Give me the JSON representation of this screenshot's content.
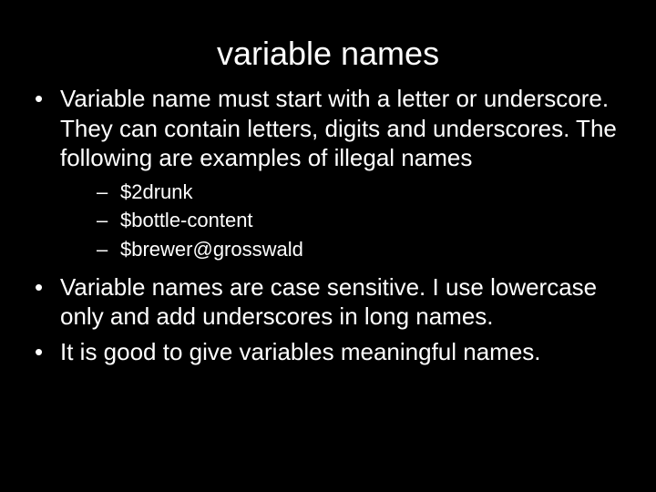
{
  "title": "variable names",
  "bullets": [
    {
      "text": "Variable name must start with a  letter or underscore. They can contain letters, digits and underscores. The following are examples of illegal names",
      "sub": [
        "$2drunk",
        "$bottle-content",
        "$brewer@grosswald"
      ]
    },
    {
      "text": "Variable names are case sensitive. I use lowercase only and add underscores in long names."
    },
    {
      "text": "It is good to give variables meaningful names."
    }
  ]
}
